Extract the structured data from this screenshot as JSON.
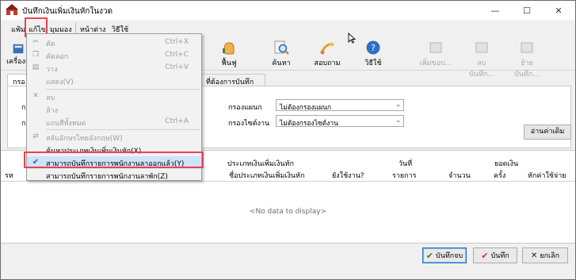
{
  "window": {
    "title": "บันทึกเงินเพิ่มเงินหักในงวด"
  },
  "menubar": {
    "items": [
      "แฟ้ม",
      "แก้ไข",
      "มุมมอง",
      "หน้าต่าง",
      "วิธีใช้"
    ]
  },
  "toolbar": {
    "left_label": "เครื่องคิ",
    "buttons": [
      "ฟื้นฟู",
      "ค้นหา",
      "สอบถาม",
      "วิธีใช้"
    ],
    "disabled_buttons": [
      "เพิ่มขอบ...",
      "ลบบันทึก...",
      "ย้ายบันทึก..."
    ]
  },
  "tabs": {
    "tab1": "กรอ",
    "tab2": "ที่ต้องการบันทึก"
  },
  "filters": {
    "left_label_1": "กร",
    "left_label_2": "กร",
    "dept_label": "กรองแผนก",
    "dept_value": "ไม่ต้องกรองแผนก",
    "work_label": "กรองไซต์งาน",
    "work_value": "ไม่ต้องกรองไซต์งาน",
    "read_button": "อ่านค่าเดิม"
  },
  "grid": {
    "header_top": {
      "type_group": "ประเภทเงินเพิ่มเงินหัก",
      "day": "วันที่",
      "amount_group": "ยอดเงิน"
    },
    "header_bottom": {
      "first": "รห",
      "type_name": "ชื่อประเภทเงินเพิ่มเงินหัก",
      "in_use": "ยังใช้งาน?",
      "item": "รายการ",
      "qty": "จำนวน",
      "times": "ครั้ง",
      "deduct": "หักค่าใช้จ่าย",
      "partial": "ล"
    },
    "empty_text": "<No data to display>"
  },
  "buttons": {
    "save_close": "บันทึกจบ",
    "save": "บันทึก",
    "cancel": "ยกเลิก"
  },
  "edit_menu": {
    "items": [
      {
        "label": "ตัด",
        "shortcut": "Ctrl+X",
        "icon": "scissors-icon"
      },
      {
        "label": "คัดลอก",
        "shortcut": "Ctrl+C",
        "icon": "copy-icon"
      },
      {
        "label": "วาง",
        "shortcut": "Ctrl+V",
        "icon": "paste-icon"
      },
      {
        "label": "แสดง(V)",
        "shortcut": "",
        "icon": ""
      },
      {
        "label": "ลบ",
        "shortcut": "",
        "icon": "delete-x-icon"
      },
      {
        "label": "ล้าง",
        "shortcut": "",
        "icon": ""
      },
      {
        "label": "แถบสีทั้งหมด",
        "shortcut": "Ctrl+A",
        "icon": ""
      },
      {
        "label": "สลับอักษรไทยอังกฤษ(W)",
        "shortcut": "",
        "icon": "swap-icon"
      },
      {
        "label": "ค้นหาประเภทเงินเพิ่มเงินหัก(X)",
        "shortcut": "",
        "icon": ""
      },
      {
        "label": "สามารถบันทึกรายการพนักงานลาออกแล้ว(Y)",
        "shortcut": "",
        "icon": "check-icon"
      },
      {
        "label": "สามารถบันทึกรายการพนักงานลาพัก(Z)",
        "shortcut": "",
        "icon": ""
      }
    ]
  },
  "colors": {
    "highlight_red": "#e8434e",
    "selected_bg": "#cfe3f7",
    "focus_blue": "#1e6fd0"
  }
}
